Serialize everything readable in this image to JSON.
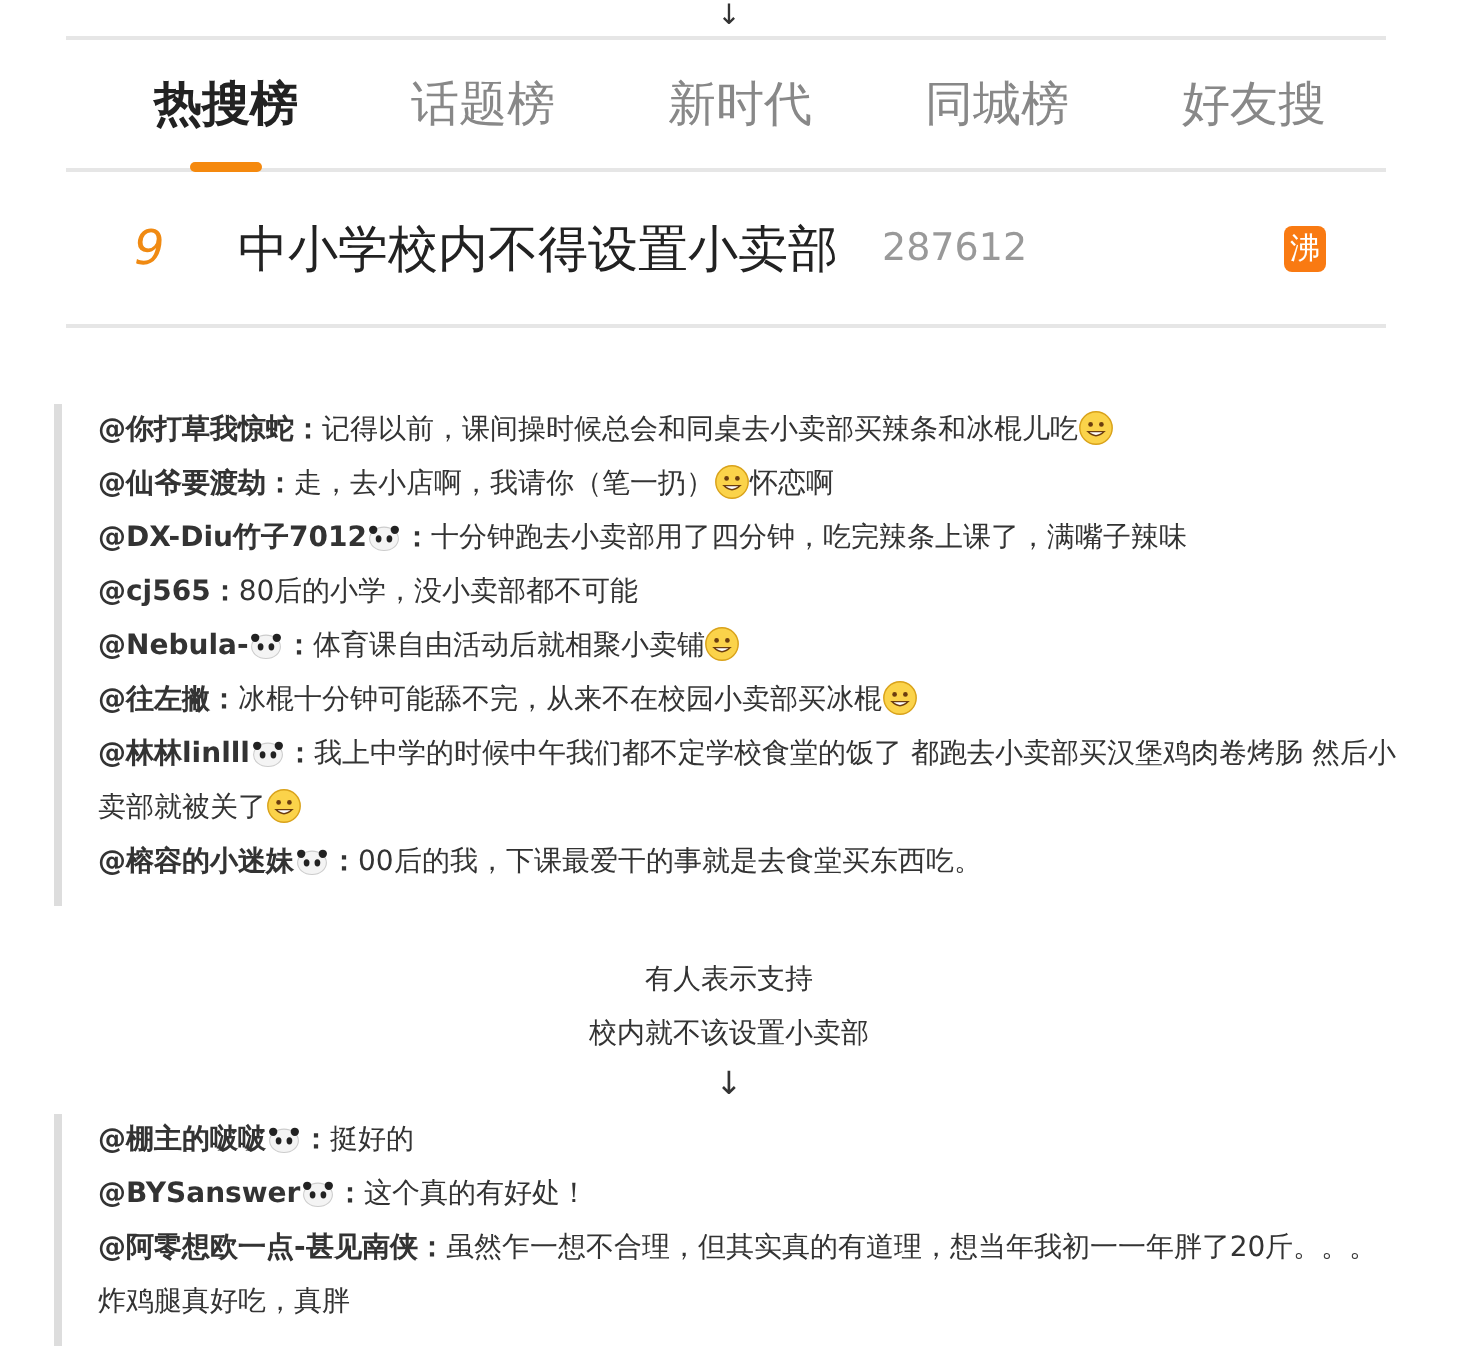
{
  "top_arrow": "↓",
  "colon": "：",
  "tabs": [
    {
      "label": "热搜榜",
      "selected": true
    },
    {
      "label": "话题榜",
      "selected": false
    },
    {
      "label": "新时代",
      "selected": false
    },
    {
      "label": "同城榜",
      "selected": false
    },
    {
      "label": "好友搜",
      "selected": false
    }
  ],
  "hot_item": {
    "rank": "9",
    "title": "中小学校内不得设置小卖部",
    "count": "287612",
    "tag": "沸"
  },
  "comment_groups": [
    {
      "comments": [
        {
          "user": "@你打草我惊蛇",
          "panda": false,
          "text": "记得以前，课间操时候总会和同桌去小卖部买辣条和冰棍儿吃",
          "emoji": true
        },
        {
          "user": "@仙爷要渡劫",
          "panda": false,
          "text": "走，去小店啊，我请你（笔一扔）",
          "emoji": true,
          "after": "怀恋啊"
        },
        {
          "user": "@DX-Diu竹子7012",
          "panda": true,
          "text": "十分钟跑去小卖部用了四分钟，吃完辣条上课了，满嘴子辣味",
          "emoji": false
        },
        {
          "user": "@cj565",
          "panda": false,
          "text": "80后的小学，没小卖部都不可能",
          "emoji": false
        },
        {
          "user": "@Nebula-",
          "panda": true,
          "text": "体育课自由活动后就相聚小卖铺",
          "emoji": true
        },
        {
          "user": "@往左撇",
          "panda": false,
          "text": "冰棍十分钟可能舔不完，从来不在校园小卖部买冰棍",
          "emoji": true
        },
        {
          "user": "@林林linlll",
          "panda": true,
          "text": "我上中学的时候中午我们都不定学校食堂的饭了 都跑去小卖部买汉堡鸡肉卷烤肠 然后小卖部就被关了",
          "emoji": true
        },
        {
          "user": "@榕容的小迷妹",
          "panda": true,
          "text": "00后的我，下课最爱干的事就是去食堂买东西吃。",
          "emoji": false
        }
      ]
    },
    {
      "caption": [
        "有人表示支持",
        "校内就不该设置小卖部"
      ],
      "arrow": "↓",
      "comments": [
        {
          "user": "@棚主的啵啵",
          "panda": true,
          "text": "挺好的",
          "emoji": false
        },
        {
          "user": "@BYSanswer",
          "panda": true,
          "text": "这个真的有好处！",
          "emoji": false
        },
        {
          "user": "@阿零想欧一点-甚见南侠",
          "panda": false,
          "text": "虽然乍一想不合理，但其实真的有道理，想当年我初一一年胖了20斤。。。炸鸡腿真好吃，真胖",
          "emoji": false
        }
      ]
    }
  ]
}
